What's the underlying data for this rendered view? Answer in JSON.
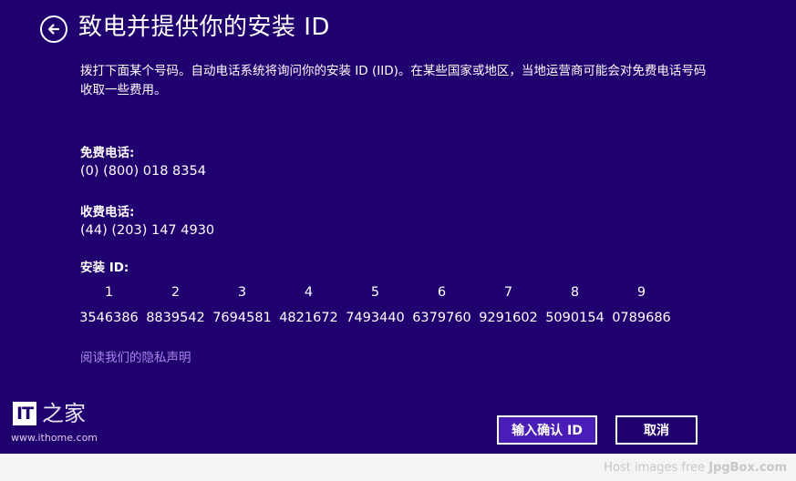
{
  "title": "致电并提供你的安装 ID",
  "intro": "拨打下面某个号码。自动电话系统将询问你的安装 ID (IID)。在某些国家或地区，当地运营商可能会对免费电话号码收取一些费用。",
  "toll_free": {
    "label": "免费电话:",
    "number": "(0) (800) 018 8354"
  },
  "toll": {
    "label": "收费电话:",
    "number": "(44) (203) 147 4930"
  },
  "installation_id": {
    "label": "安装 ID:",
    "groups": [
      {
        "index": "1",
        "value": "3546386"
      },
      {
        "index": "2",
        "value": "8839542"
      },
      {
        "index": "3",
        "value": "7694581"
      },
      {
        "index": "4",
        "value": "4821672"
      },
      {
        "index": "5",
        "value": "7493440"
      },
      {
        "index": "6",
        "value": "6379760"
      },
      {
        "index": "7",
        "value": "9291602"
      },
      {
        "index": "8",
        "value": "5090154"
      },
      {
        "index": "9",
        "value": "0789686"
      }
    ]
  },
  "privacy_link": "阅读我们的隐私声明",
  "buttons": {
    "confirm": "输入确认 ID",
    "cancel": "取消"
  },
  "watermark": {
    "logo_text": "IT",
    "logo_char": "之家",
    "url": "www.ithome.com"
  },
  "host_credit": {
    "prefix": "Host images free",
    "brand": "JpgBox.com"
  },
  "colors": {
    "background": "#1f006e",
    "link": "#a98be6",
    "primary_button": "#4a1db8",
    "text": "#ffffff"
  },
  "icons": {
    "back": "back-arrow-icon"
  }
}
